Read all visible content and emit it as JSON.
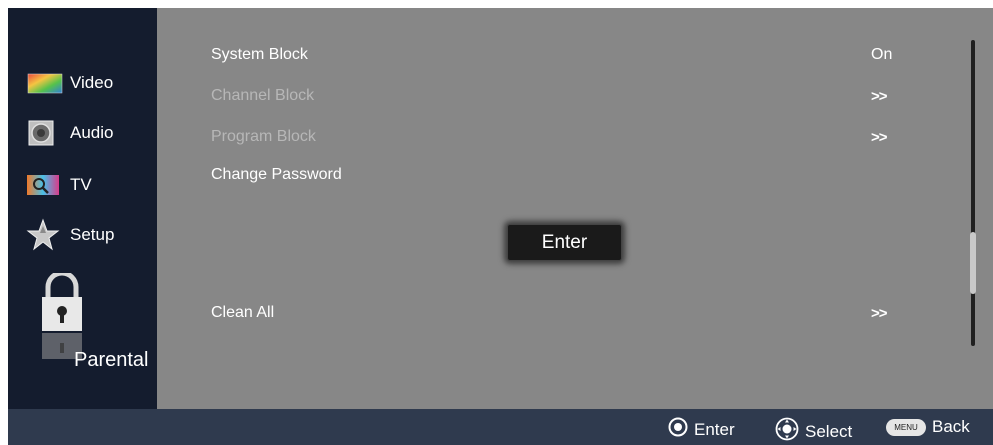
{
  "sidebar": {
    "items": [
      {
        "label": "Video",
        "icon": "video-icon"
      },
      {
        "label": "Audio",
        "icon": "speaker-icon"
      },
      {
        "label": "TV",
        "icon": "tv-icon"
      },
      {
        "label": "Setup",
        "icon": "star-icon"
      },
      {
        "label": "Parental",
        "icon": "lock-icon",
        "selected": true
      }
    ]
  },
  "main": {
    "rows": [
      {
        "label": "System Block",
        "value": "On",
        "enabled": true
      },
      {
        "label": "Channel Block",
        "value": ">>",
        "enabled": false
      },
      {
        "label": "Program Block",
        "value": ">>",
        "enabled": false
      },
      {
        "label": "Change Password",
        "value": "",
        "enabled": true
      },
      {
        "label": "Clean All",
        "value": ">>",
        "enabled": true
      }
    ],
    "enter_button": "Enter",
    "scroll_position": 0.63
  },
  "bottombar": {
    "enter_label": "Enter",
    "select_label": "Select",
    "back_label": "Back",
    "menu_key": "MENU"
  },
  "colors": {
    "sidebar_bg": "#141c2e",
    "panel_bg": "#878787",
    "bottombar_bg": "#2f3a4e",
    "disabled_text": "#b7b7b7"
  }
}
